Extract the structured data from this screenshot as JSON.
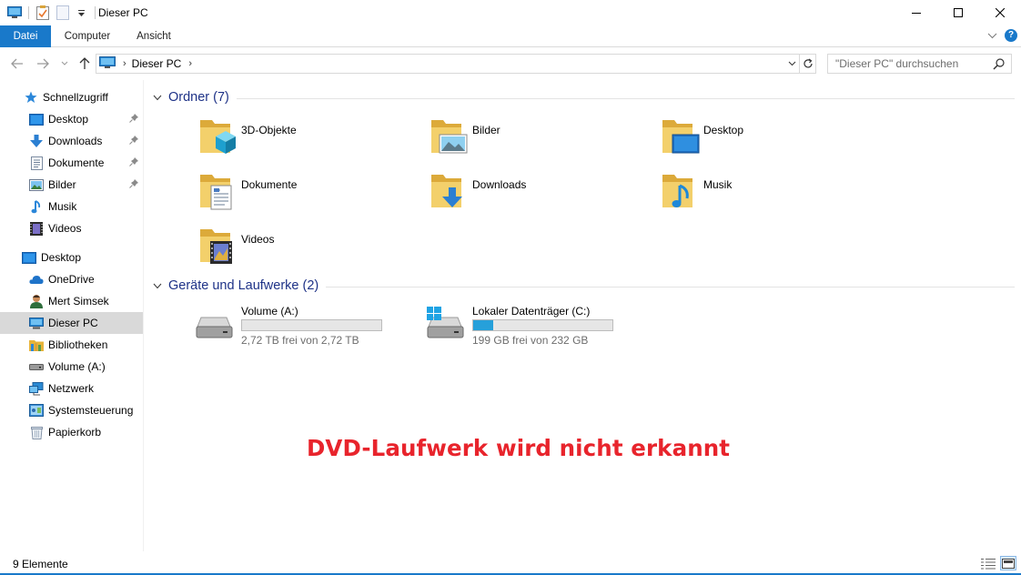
{
  "window": {
    "title": "Dieser PC"
  },
  "ribbon": {
    "tabs": [
      "Datei",
      "Computer",
      "Ansicht"
    ],
    "help_label": "?"
  },
  "address": {
    "crumb": "Dieser PC",
    "search_placeholder": "\"Dieser PC\" durchsuchen"
  },
  "sidebar": {
    "items": [
      {
        "label": "Schnellzugriff",
        "icon": "star-icon",
        "pinned": false
      },
      {
        "label": "Desktop",
        "icon": "desktop-icon",
        "pinned": true
      },
      {
        "label": "Downloads",
        "icon": "download-icon",
        "pinned": true
      },
      {
        "label": "Dokumente",
        "icon": "document-icon",
        "pinned": true
      },
      {
        "label": "Bilder",
        "icon": "pictures-icon",
        "pinned": true
      },
      {
        "label": "Musik",
        "icon": "music-icon",
        "pinned": false
      },
      {
        "label": "Videos",
        "icon": "videos-icon",
        "pinned": false
      },
      {
        "label": "Desktop",
        "icon": "desktop-icon",
        "pinned": false
      },
      {
        "label": "OneDrive",
        "icon": "cloud-icon",
        "pinned": false
      },
      {
        "label": "Mert Simsek",
        "icon": "user-icon",
        "pinned": false
      },
      {
        "label": "Dieser PC",
        "icon": "computer-icon",
        "pinned": false,
        "selected": true
      },
      {
        "label": "Bibliotheken",
        "icon": "libraries-icon",
        "pinned": false
      },
      {
        "label": "Volume (A:)",
        "icon": "drive-icon",
        "pinned": false
      },
      {
        "label": "Netzwerk",
        "icon": "network-icon",
        "pinned": false
      },
      {
        "label": "Systemsteuerung",
        "icon": "control-panel-icon",
        "pinned": false
      },
      {
        "label": "Papierkorb",
        "icon": "recycle-bin-icon",
        "pinned": false
      }
    ]
  },
  "folders_group": {
    "title": "Ordner (7)",
    "items": [
      {
        "label": "3D-Objekte",
        "icon": "3d-objects-folder-icon"
      },
      {
        "label": "Bilder",
        "icon": "pictures-folder-icon"
      },
      {
        "label": "Desktop",
        "icon": "desktop-folder-icon"
      },
      {
        "label": "Dokumente",
        "icon": "documents-folder-icon"
      },
      {
        "label": "Downloads",
        "icon": "downloads-folder-icon"
      },
      {
        "label": "Musik",
        "icon": "music-folder-icon"
      },
      {
        "label": "Videos",
        "icon": "videos-folder-icon"
      }
    ]
  },
  "drives_group": {
    "title": "Geräte und Laufwerke (2)",
    "items": [
      {
        "label": "Volume (A:)",
        "free_text": "2,72 TB frei von 2,72 TB",
        "used_fraction": 0.0,
        "icon": "hard-drive-icon"
      },
      {
        "label": "Lokaler Datenträger (C:)",
        "free_text": "199 GB frei von 232 GB",
        "used_fraction": 0.142,
        "icon": "windows-drive-icon"
      }
    ]
  },
  "overlay_text": "DVD-Laufwerk wird nicht erkannt",
  "status": {
    "count": "9 Elemente"
  },
  "colors": {
    "accent": "#1979ca",
    "group_title": "#1e3287",
    "overlay": "#e8242c",
    "drive_fill": "#26a0da",
    "selected_bg": "#d9d9d9"
  }
}
